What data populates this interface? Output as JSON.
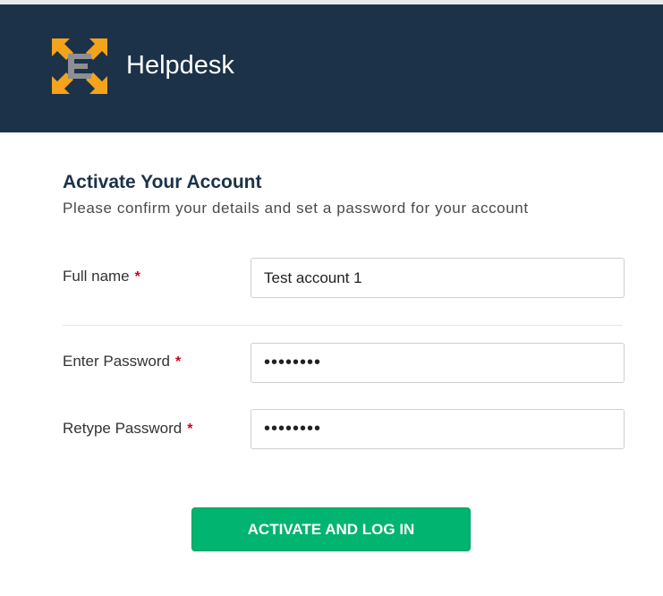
{
  "header": {
    "brand": "Helpdesk",
    "background": "#1b3249",
    "logo_icon": "helpdesk-e-logo-icon"
  },
  "form": {
    "title": "Activate Your Account",
    "subtitle": "Please confirm your details and set a password for your account",
    "required_marker": "*",
    "fields": {
      "full_name": {
        "label": "Full name",
        "value": "Test account 1"
      },
      "password": {
        "label": "Enter Password",
        "value": "••••••••"
      },
      "retype_password": {
        "label": "Retype Password",
        "value": "••••••••"
      }
    },
    "submit_label": "ACTIVATE AND LOG IN",
    "submit_color": "#01b46f"
  }
}
